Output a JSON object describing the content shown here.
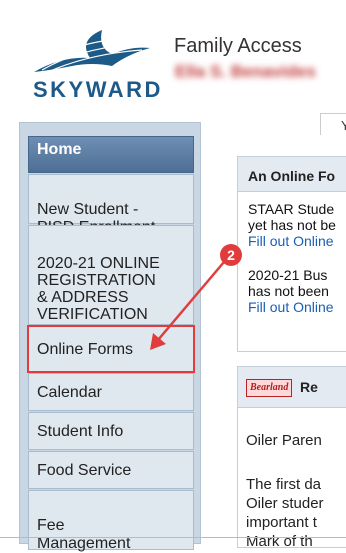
{
  "header": {
    "brand": "SKYWARD",
    "app_title": "Family Access",
    "user_name": "Ella S. Benavides"
  },
  "tabs": [
    {
      "label": "Y"
    }
  ],
  "sidebar": {
    "items": [
      {
        "label": "Home"
      },
      {
        "label": "New Student -\nPISD Enrollment"
      },
      {
        "label": "2020-21 ONLINE\nREGISTRATION\n& ADDRESS\nVERIFICATION"
      },
      {
        "label": "Online Forms"
      },
      {
        "label": "Calendar"
      },
      {
        "label": "Student Info"
      },
      {
        "label": "Food Service"
      },
      {
        "label": "Fee\nManagement"
      }
    ]
  },
  "online_forms_panel": {
    "title": "An Online Fo",
    "messages": [
      {
        "line1": "STAAR Stude",
        "line2": "yet has not be",
        "link": "Fill out Online"
      },
      {
        "line1": "2020-21 Bus",
        "line2": "has not been",
        "link": "Fill out Online"
      }
    ]
  },
  "news_panel": {
    "logo_text": "Bearland",
    "title": "Re",
    "lines": [
      "Oiler Paren",
      "The first da",
      "Oiler studer",
      "important t",
      "Mark of th"
    ]
  },
  "annotation": {
    "step": "2",
    "color": "#e13c3c"
  }
}
